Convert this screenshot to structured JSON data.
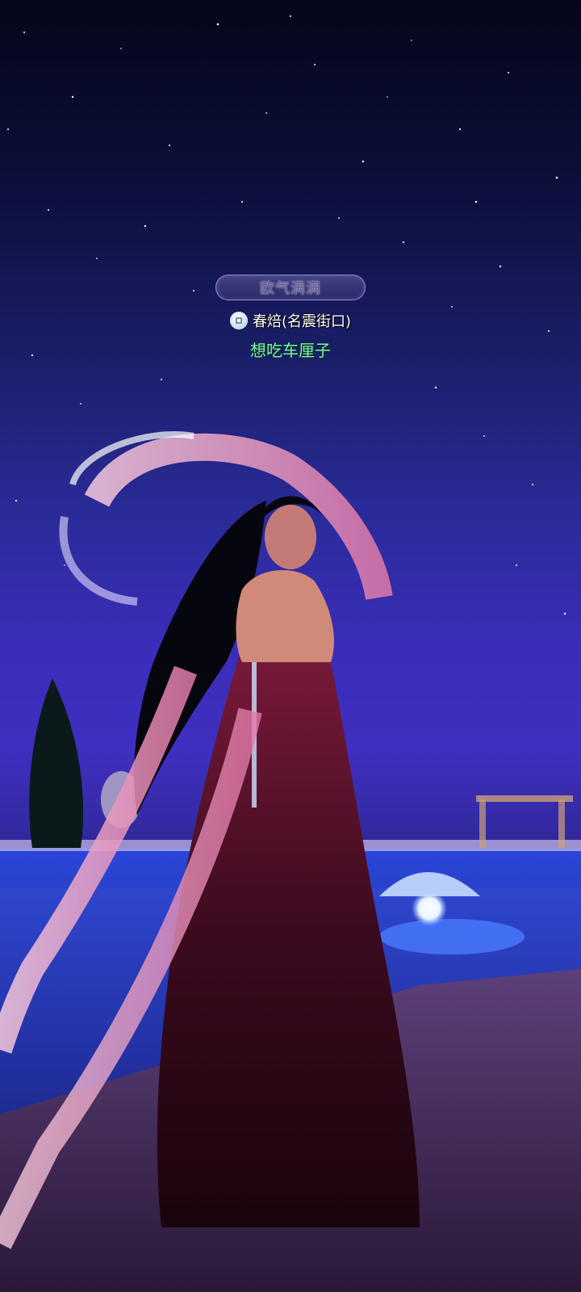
{
  "nameplate": {
    "title_badge": "欧气满满",
    "server_icon": "server-badge-icon",
    "player_name": "春焙(名震街口)",
    "guild_name": "想吃车厘子"
  },
  "colors": {
    "sky_top": "#05061a",
    "sky_mid": "#3f2fc0",
    "guild_text": "#7ef0b0",
    "ribbon_pink": "#f2b8d0",
    "dress_dark": "#2a0a14"
  }
}
